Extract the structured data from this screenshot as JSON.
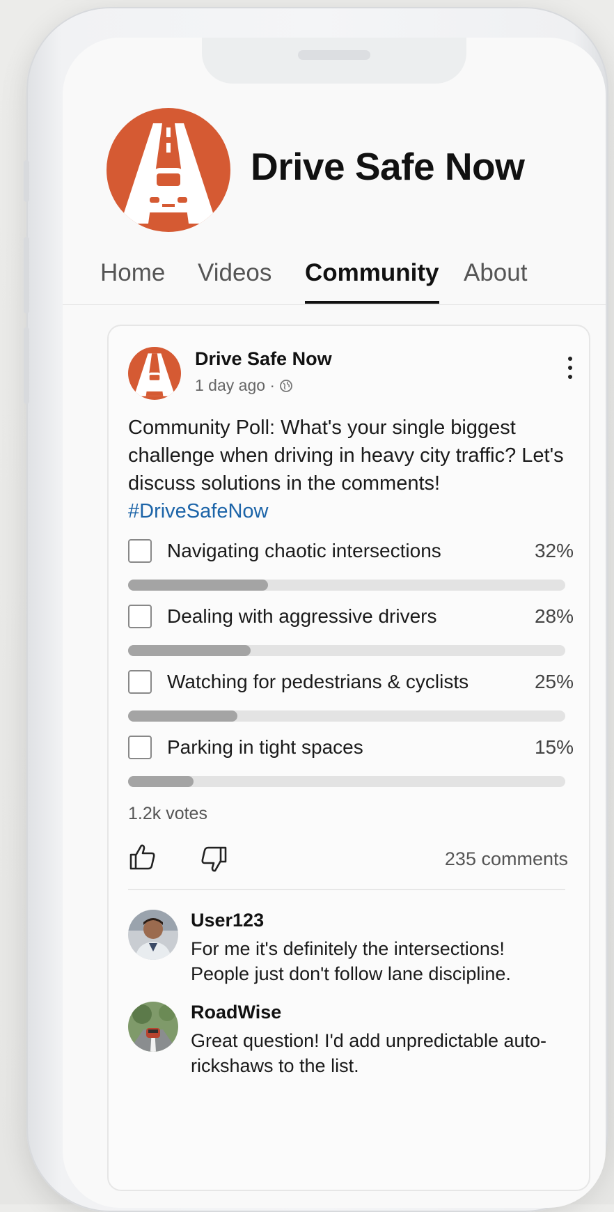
{
  "channel": {
    "name": "Drive Safe Now",
    "brand_color": "#d55a33"
  },
  "tabs": [
    {
      "label": "Home"
    },
    {
      "label": "Videos"
    },
    {
      "label": "Community",
      "active": true
    },
    {
      "label": "About"
    }
  ],
  "post": {
    "author": "Drive Safe Now",
    "time": "1 day ago ·",
    "visibility_icon": "globe-icon",
    "text": "Community Poll: What's your single biggest challenge when driving in heavy city traffic? Let's discuss solutions in the comments!",
    "hashtag": "#DriveSafeNow",
    "poll": {
      "options": [
        {
          "label": "Navigating chaotic intersections",
          "percent_text": "32%",
          "fraction": 0.32
        },
        {
          "label": "Dealing with aggressive drivers",
          "percent_text": "28%",
          "fraction": 0.28
        },
        {
          "label": "Watching for pedestrians & cyclists",
          "percent_text": "25%",
          "fraction": 0.25
        },
        {
          "label": "Parking in tight spaces",
          "percent_text": "15%",
          "fraction": 0.15
        }
      ],
      "votes": "1.2k votes"
    },
    "comments_count": "235 comments"
  },
  "comments": [
    {
      "user": "User123",
      "text": "For me it's definitely the intersections! People just don't follow lane discipline."
    },
    {
      "user": "RoadWise",
      "text": "Great question! I'd add unpredictable auto-rickshaws to the list."
    }
  ],
  "colors": {
    "hashtag": "#1c64a8",
    "bar_fill": "#a4a4a4",
    "bar_track": "#e3e3e3"
  }
}
